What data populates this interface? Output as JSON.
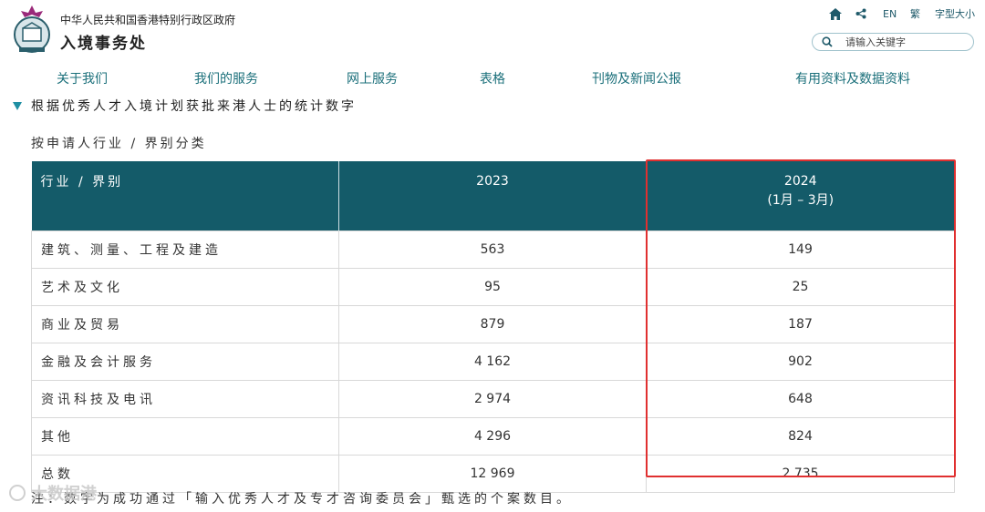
{
  "header": {
    "gov_name": "中华人民共和国香港特别行政区政府",
    "dept_name": "入境事务处",
    "lang_en": "EN",
    "lang_trad": "繁",
    "font_size": "字型大小",
    "search_placeholder": "请输入关键字"
  },
  "nav": [
    "关于我们",
    "我们的服务",
    "网上服务",
    "表格",
    "刊物及新闻公报",
    "有用资料及数据资料"
  ],
  "page_title": "根据优秀人才入境计划获批来港人士的统计数字",
  "subtitle": "按申请人行业 / 界别分类",
  "table": {
    "headers": [
      "行业 / 界别",
      "2023",
      "2024",
      "(1月 – 3月)"
    ],
    "rows": [
      {
        "label": "建筑、测量、工程及建造",
        "y2023": "563",
        "y2024": "149"
      },
      {
        "label": "艺术及文化",
        "y2023": "95",
        "y2024": "25"
      },
      {
        "label": "商业及贸易",
        "y2023": "879",
        "y2024": "187"
      },
      {
        "label": "金融及会计服务",
        "y2023": "4 162",
        "y2024": "902"
      },
      {
        "label": "资讯科技及电讯",
        "y2023": "2 974",
        "y2024": "648"
      },
      {
        "label": "其他",
        "y2023": "4 296",
        "y2024": "824"
      },
      {
        "label": "总数",
        "y2023": "12 969",
        "y2024": "2 735"
      }
    ]
  },
  "note": "注：数字为成功通过「输入优秀人才及专才咨询委员会」甄选的个案数目。",
  "watermark": "大数据港",
  "colors": {
    "header_bg": "#145b69",
    "nav": "#1a6f7a",
    "highlight": "#e03030"
  }
}
